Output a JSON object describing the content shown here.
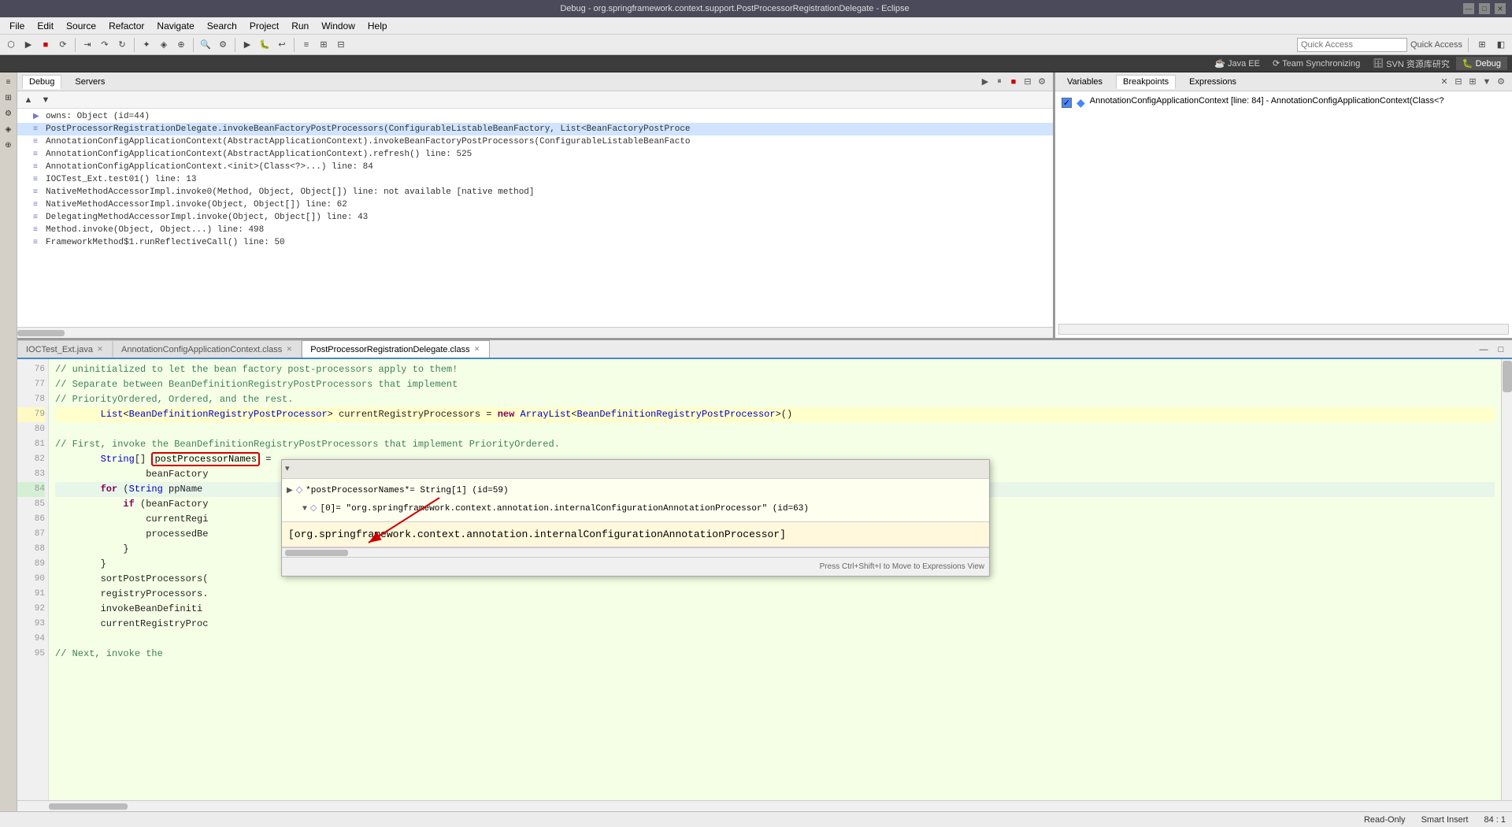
{
  "titleBar": {
    "title": "Debug - org.springframework.context.support.PostProcessorRegistrationDelegate - Eclipse",
    "minimize": "—",
    "maximize": "□",
    "close": "✕"
  },
  "menuBar": {
    "items": [
      "File",
      "Edit",
      "Source",
      "Refactor",
      "Navigate",
      "Search",
      "Project",
      "Run",
      "Window",
      "Help"
    ]
  },
  "toolbar": {
    "quickAccessLabel": "Quick Access"
  },
  "perspectiveBar": {
    "items": [
      "Java EE",
      "Team Synchronizing",
      "SVN 资源库研究",
      "Debug"
    ]
  },
  "debugPanel": {
    "title": "Debug",
    "tabs": [
      "Debug",
      "Servers"
    ],
    "stackItems": [
      "owns: Object  (id=44)",
      "PostProcessorRegistrationDelegate.invokeBeanFactoryPostProcessors(ConfigurableListableBeanFactory, List<BeanFactoryPostProce",
      "AnnotationConfigApplicationContext(AbstractApplicationContext).invokeBeanFactoryPostProcessors(ConfigurableListableBeanFacto",
      "AnnotationConfigApplicationContext(AbstractApplicationContext).refresh() line: 525",
      "AnnotationConfigApplicationContext.<init>(Class<?>...) line: 84",
      "IOCTest_Ext.test01() line: 13",
      "NativeMethodAccessorImpl.invoke0(Method, Object, Object[]) line: not available [native method]",
      "NativeMethodAccessorImpl.invoke(Object, Object[]) line: 62",
      "DelegatingMethodAccessorImpl.invoke(Object, Object[]) line: 43",
      "Method.invoke(Object, Object...) line: 498",
      "FrameworkMethod$1.runReflectiveCall() line: 50"
    ]
  },
  "varsPanel": {
    "tabs": [
      "Variables",
      "Breakpoints",
      "Expressions"
    ],
    "breakpointItem": "AnnotationConfigApplicationContext [line: 84] - AnnotationConfigApplicationContext(Class<?"
  },
  "editorTabs": [
    {
      "label": "IOCTest_Ext.java",
      "active": false
    },
    {
      "label": "AnnotationConfigApplicationContext.class",
      "active": false
    },
    {
      "label": "PostProcessorRegistrationDelegate.class",
      "active": true
    }
  ],
  "codeLines": [
    {
      "num": 76,
      "text": "        // uninitialized to let the bean factory post-processors apply to them!"
    },
    {
      "num": 77,
      "text": "        // Separate between BeanDefinitionRegistryPostProcessors that implement"
    },
    {
      "num": 78,
      "text": "        // PriorityOrdered, Ordered, and the rest."
    },
    {
      "num": 79,
      "text": "        List<BeanDefinitionRegistryPostProcessor> currentRegistryProcessors = new ArrayList<BeanDefinitionRegistryPostProcessor>()"
    },
    {
      "num": 80,
      "text": ""
    },
    {
      "num": 81,
      "text": "        // First, invoke the BeanDefinitionRegistryPostProcessors that implement PriorityOrdered."
    },
    {
      "num": 82,
      "text": "        String[] postProcessorNames ="
    },
    {
      "num": 83,
      "text": "                beanFactory"
    },
    {
      "num": 84,
      "text": "        for (String ppName"
    },
    {
      "num": 85,
      "text": "            if (beanFactory"
    },
    {
      "num": 86,
      "text": "                currentRegi"
    },
    {
      "num": 87,
      "text": "                processedBe"
    },
    {
      "num": 88,
      "text": "            }"
    },
    {
      "num": 89,
      "text": "        }"
    },
    {
      "num": 90,
      "text": "        sortPostProcessors("
    },
    {
      "num": 91,
      "text": "        registryProcessors."
    },
    {
      "num": 92,
      "text": "        invokeBeanDefiniti"
    },
    {
      "num": 93,
      "text": "        currentRegistryProc"
    },
    {
      "num": 94,
      "text": ""
    },
    {
      "num": 95,
      "text": "        // Next, invoke the"
    }
  ],
  "debugPopup": {
    "varName": "*postProcessorNames*= String[1]  (id=59)",
    "childName": "[0]= \"org.springframework.context.annotation.internalConfigurationAnnotationProcessor\" (id=63)",
    "bottomValue": "[org.springframework.context.annotation.internalConfigurationAnnotationProcessor]",
    "statusText": "Press Ctrl+Shift+I to Move to Expressions View"
  },
  "statusBar": {
    "readOnly": "Read-Only",
    "insertMode": "Smart Insert",
    "position": "84 : 1"
  }
}
